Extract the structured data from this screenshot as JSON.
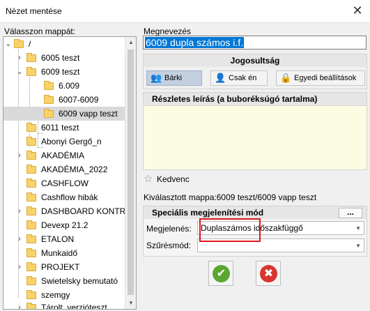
{
  "window": {
    "title": "Nézet mentése",
    "close_glyph": "✕"
  },
  "folders": {
    "label": "Válasszon mappát:",
    "items": [
      {
        "label": "/",
        "expanded": true
      },
      {
        "label": "6005 teszt"
      },
      {
        "label": "6009 teszt",
        "expanded": true
      },
      {
        "label": "6.009"
      },
      {
        "label": "6007-6009"
      },
      {
        "label": "6009 vapp teszt",
        "selected": true
      },
      {
        "label": "6011 teszt"
      },
      {
        "label": "Abonyi Gergő_n"
      },
      {
        "label": "AKADÉMIA"
      },
      {
        "label": "AKADÉMIA_2022"
      },
      {
        "label": "CASHFLOW"
      },
      {
        "label": "Cashflow hibák"
      },
      {
        "label": "DASHBOARD KONTRO..."
      },
      {
        "label": "Devexp 21.2"
      },
      {
        "label": "ETALON"
      },
      {
        "label": "Munkaidő"
      },
      {
        "label": "PROJEKT"
      },
      {
        "label": "Swietelsky bemutató"
      },
      {
        "label": "szemgy"
      },
      {
        "label": "Tárolt_verzióteszt"
      }
    ]
  },
  "name": {
    "label": "Megnevezés",
    "value": "6009 dupla számos i.f."
  },
  "permissions": {
    "header": "Jogosultság",
    "options": [
      {
        "label": "Bárki",
        "icon": "group-icon",
        "active": true
      },
      {
        "label": "Csak én",
        "icon": "user-icon"
      },
      {
        "label": "Egyedi beállítások",
        "icon": "lock-icon"
      }
    ]
  },
  "description": {
    "header": "Részletes leírás (a buboréksúgó tartalma)",
    "value": ""
  },
  "favorite": {
    "label": "Kedvenc",
    "checked": false
  },
  "selected_folder": "Kiválasztott mappa:6009 teszt/6009 vapp teszt",
  "special": {
    "header": "Speciális megjelenítési mód",
    "more_label": "...",
    "display_label": "Megjelenés:",
    "display_value": "Duplaszámos időszakfüggő",
    "filter_label": "Szűrésmód:",
    "filter_value": ""
  },
  "colors": {
    "accent": "#0078d7",
    "highlight_box": "#e0161c",
    "ok_green": "#5aa832",
    "cancel_red": "#d9362e",
    "description_bg": "#fcfce3"
  }
}
